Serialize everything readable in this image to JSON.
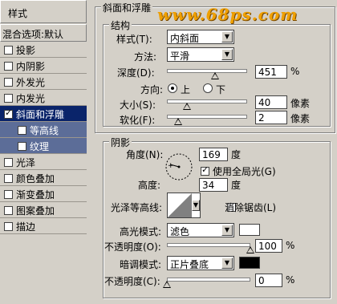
{
  "sidebar": {
    "header": "样式",
    "blend": "混合选项:默认",
    "items": [
      {
        "label": "投影",
        "checked": false
      },
      {
        "label": "内阴影",
        "checked": false
      },
      {
        "label": "外发光",
        "checked": false
      },
      {
        "label": "内发光",
        "checked": false
      },
      {
        "label": "斜面和浮雕",
        "checked": true
      },
      {
        "label": "等高线",
        "checked": false
      },
      {
        "label": "纹理",
        "checked": false
      },
      {
        "label": "光泽",
        "checked": false
      },
      {
        "label": "颜色叠加",
        "checked": false
      },
      {
        "label": "渐变叠加",
        "checked": false
      },
      {
        "label": "图案叠加",
        "checked": false
      },
      {
        "label": "描边",
        "checked": false
      }
    ]
  },
  "watermark": "www.68ps.com",
  "bevel": {
    "title": "斜面和浮雕",
    "structure_title": "结构",
    "style_label": "样式(T):",
    "style_value": "内斜面",
    "method_label": "方法:",
    "method_value": "平滑",
    "depth_label": "深度(D):",
    "depth_value": "451",
    "depth_unit": "%",
    "direction_label": "方向:",
    "dir_up": "上",
    "dir_down": "下",
    "size_label": "大小(S):",
    "size_value": "40",
    "size_unit": "像素",
    "soften_label": "软化(F):",
    "soften_value": "2",
    "soften_unit": "像素"
  },
  "shading": {
    "title": "阴影",
    "angle_label": "角度(N):",
    "angle_value": "169",
    "angle_unit": "度",
    "global_light_label": "使用全局光(G)",
    "altitude_label": "高度:",
    "altitude_value": "34",
    "altitude_unit": "度",
    "gloss_label": "光泽等高线:",
    "antialias_label": "消除锯齿(L)",
    "highlight_label": "高光模式:",
    "highlight_value": "滤色",
    "highlight_color": "#ffffff",
    "hl_opacity_label": "不透明度(O):",
    "hl_opacity_value": "100",
    "hl_opacity_unit": "%",
    "shadow_label": "暗调模式:",
    "shadow_value": "正片叠底",
    "shadow_color": "#000000",
    "sh_opacity_label": "不透明度(C):",
    "sh_opacity_value": "0",
    "sh_opacity_unit": "%"
  }
}
